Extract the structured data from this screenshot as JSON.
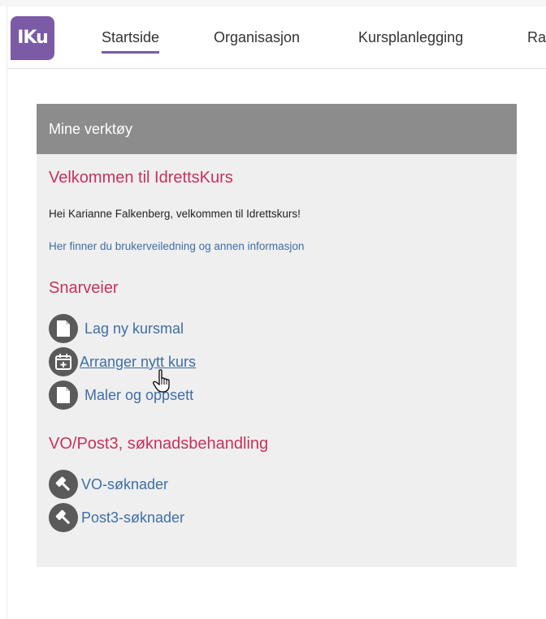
{
  "header": {
    "logo_text": "IKu",
    "nav": [
      {
        "label": "Startside",
        "active": true
      },
      {
        "label": "Organisasjon",
        "active": false
      },
      {
        "label": "Kursplanlegging",
        "active": false
      },
      {
        "label": "Rap",
        "active": false
      }
    ]
  },
  "panel": {
    "title": "Mine verktøy",
    "welcome_heading": "Velkommen til IdrettsKurs",
    "greeting": "Hei Karianne Falkenberg, velkommen til Idrettskurs!",
    "info_link": "Her finner du brukerveiledning og annen informasjon",
    "shortcuts_heading": "Snarveier",
    "shortcuts": [
      {
        "label": "Lag ny kursmal",
        "icon": "document-icon"
      },
      {
        "label": " Arranger nytt kurs",
        "icon": "calendar-add-icon"
      },
      {
        "label": "Maler og oppsett",
        "icon": "document-icon"
      }
    ],
    "applications_heading": "VO/Post3, søknadsbehandling",
    "applications": [
      {
        "label": "VO-søknader",
        "icon": "gavel-icon"
      },
      {
        "label": "Post3-søknader",
        "icon": "gavel-icon"
      }
    ]
  },
  "colors": {
    "brand": "#7b5aa6",
    "heading_red": "#c8325a",
    "link_blue": "#3f6ea6",
    "panel_header": "#8c8c8c",
    "panel_bg": "#efefef"
  }
}
